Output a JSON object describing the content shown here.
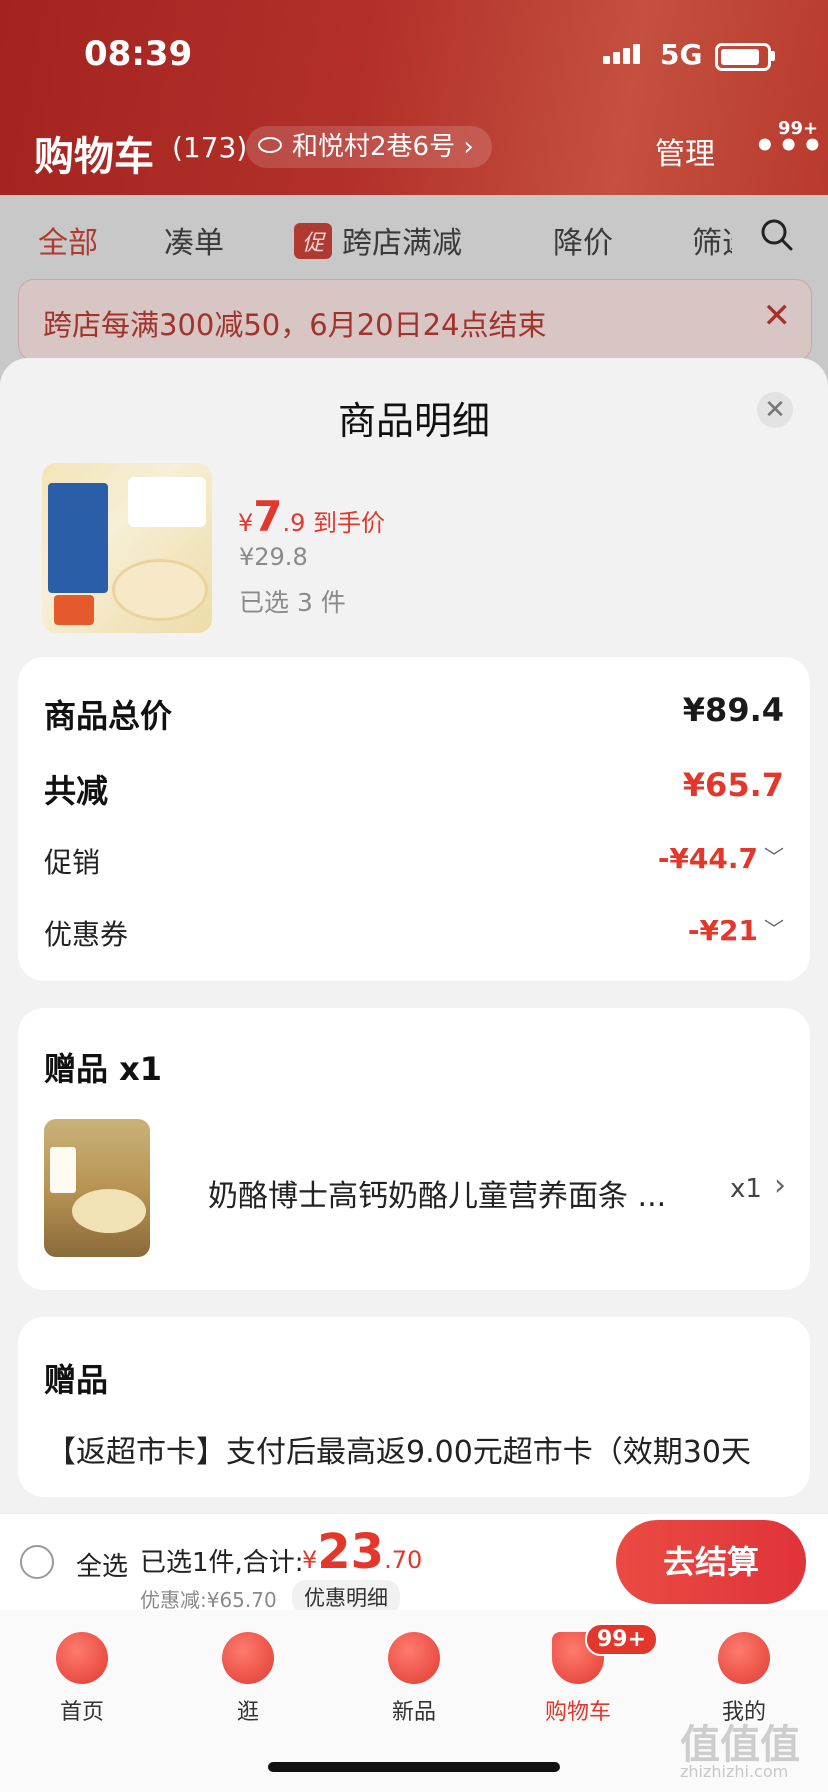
{
  "status_bar": {
    "time": "08:39",
    "network": "5G"
  },
  "header": {
    "title": "购物车",
    "count": "(173)",
    "address": "和悦村2巷6号 ›",
    "manage": "管理",
    "more": "•••",
    "more_badge": "99+"
  },
  "filter_tabs": [
    {
      "label": "全部",
      "active": true
    },
    {
      "label": "凑单"
    },
    {
      "label": "跨店满减",
      "tag": "促"
    },
    {
      "label": "降价"
    },
    {
      "label": "筛选"
    }
  ],
  "promo_banner": {
    "text": "跨店每满300减50，6月20日24点结束",
    "close": "✕"
  },
  "sheet": {
    "title": "商品明细",
    "close": "✕",
    "product": {
      "currency": "¥",
      "price_int": "7",
      "price_dec": ".9",
      "price_note": " 到手价",
      "original_price": "¥29.8",
      "selected": "已选 3 件"
    },
    "summary": {
      "total_label": "商品总价",
      "total_value": "¥89.4",
      "reduce_label": "共减",
      "reduce_value": "¥65.7",
      "promo_label": "促销",
      "promo_value": "-¥44.7",
      "coupon_label": "优惠券",
      "coupon_value": "-¥21"
    },
    "gift": {
      "title": "赠品 x1",
      "name": "奶酪博士高钙奶酪儿童营养面条 ...",
      "qty": "x1",
      "arrow": "›"
    },
    "gift2": {
      "title": "赠品",
      "text": "【返超市卡】支付后最高返9.00元超市卡（效期30天"
    }
  },
  "bottom_bar": {
    "select_all": "全选",
    "summary_label": "已选1件,合计:",
    "currency": "¥",
    "total_int": "23",
    "total_dec": ".70",
    "discount": "优惠减:¥65.70",
    "detail": "优惠明细",
    "checkout": "去结算"
  },
  "tab_bar": [
    {
      "label": "首页",
      "icon": "home-icon"
    },
    {
      "label": "逛",
      "icon": "browse-icon"
    },
    {
      "label": "新品",
      "icon": "new-icon"
    },
    {
      "label": "购物车",
      "icon": "cart-icon",
      "active": true,
      "badge": "99+"
    },
    {
      "label": "我的",
      "icon": "profile-icon"
    }
  ],
  "watermark": {
    "logo": "值值值",
    "site": "zhizhizhi.com"
  },
  "colors": {
    "header": "#b3312a",
    "accent": "#e4372c"
  }
}
